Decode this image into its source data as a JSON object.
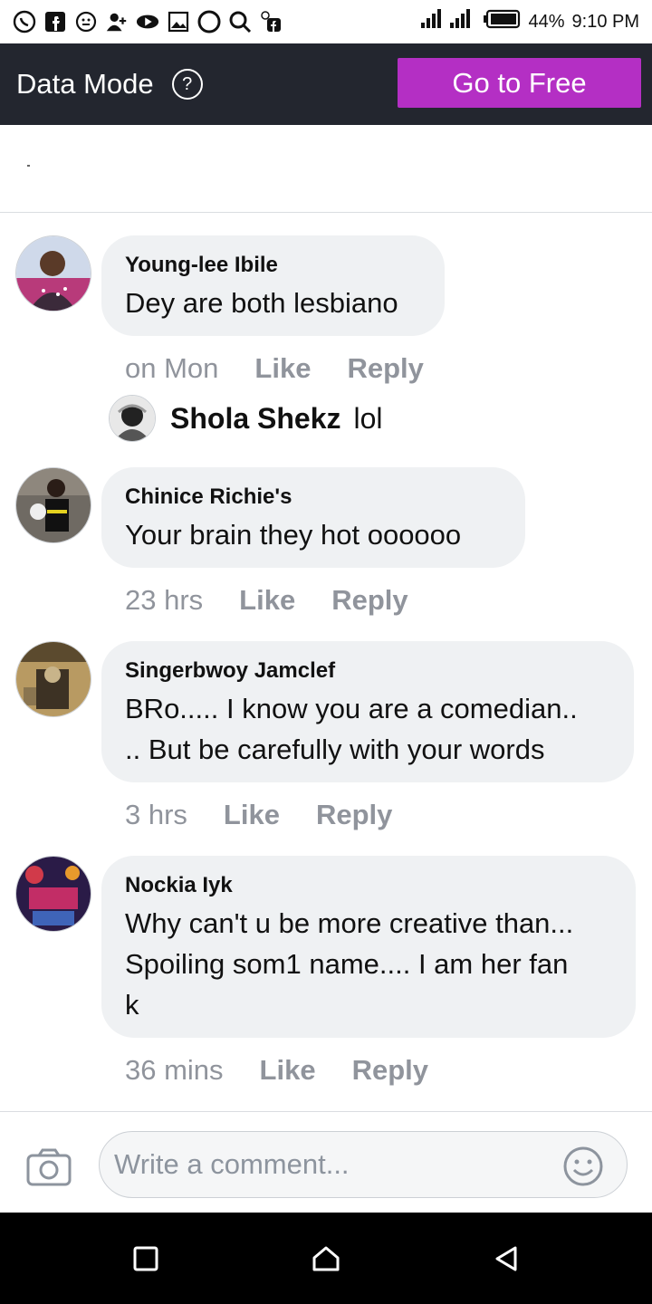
{
  "status_bar": {
    "battery_percent": "44%",
    "time": "9:10 PM"
  },
  "data_mode_bar": {
    "label": "Data Mode",
    "help_symbol": "?",
    "go_free_label": "Go to Free"
  },
  "comments": [
    {
      "author": "Young-lee Ibile",
      "lines": [
        "Dey are both lesbiano"
      ],
      "time": "on Mon",
      "like": "Like",
      "reply": "Reply",
      "avatar_icon": "profile-photo"
    },
    {
      "author": "Chinice Richie's",
      "lines": [
        "Your  brain they hot oooooo"
      ],
      "time": "23 hrs",
      "like": "Like",
      "reply": "Reply",
      "avatar_icon": "profile-photo"
    },
    {
      "author": "Singerbwoy Jamclef",
      "lines": [
        "BRo..... I know you are a comedian..",
        ".. But be carefully with your words"
      ],
      "time": "3 hrs",
      "like": "Like",
      "reply": "Reply",
      "avatar_icon": "profile-photo"
    },
    {
      "author": "Nockia Iyk",
      "lines": [
        "Why can't u be more creative than...",
        "Spoiling som1 name.... I am her fan",
        "k"
      ],
      "time": "36 mins",
      "like": "Like",
      "reply": "Reply",
      "avatar_icon": "profile-photo"
    }
  ],
  "reply_preview": {
    "name": "Shola Shekz",
    "text": "lol"
  },
  "composer": {
    "placeholder": "Write a comment..."
  },
  "colors": {
    "data_bar_bg": "#23262f",
    "go_free_bg": "#b42fc4",
    "bubble_bg": "#eff1f3",
    "meta_text": "#90949c"
  }
}
